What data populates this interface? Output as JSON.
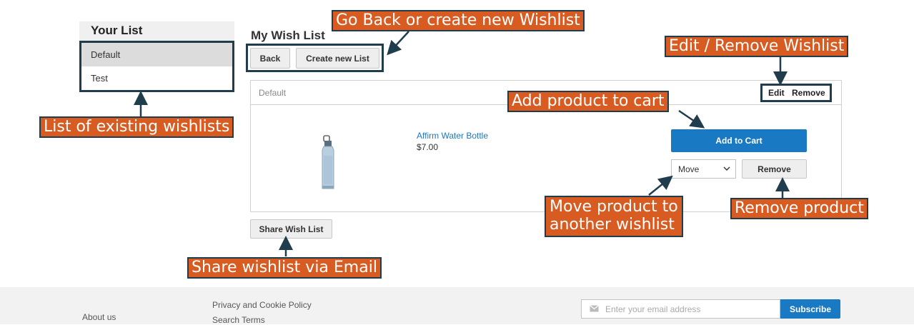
{
  "sidebar": {
    "title": "Your List",
    "items": [
      {
        "label": "Default",
        "active": true
      },
      {
        "label": "Test",
        "active": false
      }
    ]
  },
  "main": {
    "title": "My Wish List",
    "back_label": "Back",
    "create_label": "Create new List",
    "share_label": "Share Wish List"
  },
  "wishlist": {
    "name": "Default",
    "edit_label": "Edit",
    "remove_label": "Remove"
  },
  "product": {
    "name": "Affirm Water Bottle",
    "price": "$7.00",
    "add_to_cart_label": "Add to Cart",
    "move_selected": "Move",
    "remove_label": "Remove"
  },
  "annotations": {
    "go_back": "Go Back or create new Wishlist",
    "edit_remove": "Edit / Remove Wishlist",
    "add_to_cart": "Add product to cart",
    "list_existing": "List of existing wishlists",
    "move_line1": "Move product to",
    "move_line2": "another wishlist",
    "remove_product": "Remove product",
    "share": "Share wishlist via Email"
  },
  "footer": {
    "about": "About us",
    "privacy": "Privacy and Cookie Policy",
    "search_terms": "Search Terms",
    "email_placeholder": "Enter your email address",
    "subscribe_label": "Subscribe"
  },
  "colors": {
    "annotation_bg": "#d85b21",
    "annotation_border": "#1f3d4d",
    "primary_blue": "#1979c3"
  },
  "icons": {
    "mail": "mail-icon",
    "chevron": "chevron-down-icon",
    "product_image": "water-bottle-image"
  }
}
